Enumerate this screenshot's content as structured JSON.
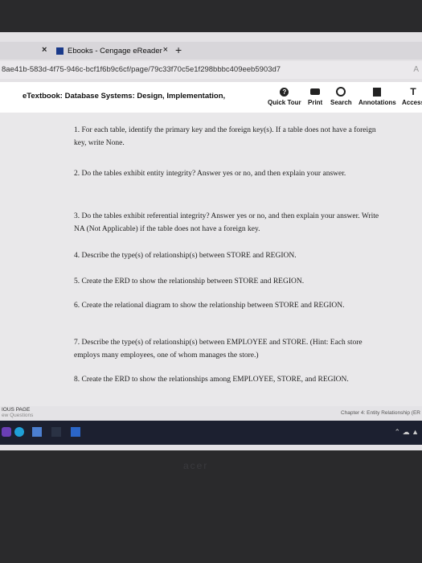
{
  "browser": {
    "tab_title": "Ebooks - Cengage eReader",
    "tab_close": "×",
    "new_tab": "+",
    "left_close": "×",
    "url": "8ae41b-583d-4f75-946c-bcf1f6b9c6cf/page/79c33f70c5e1f298bbbc409eeb5903d7",
    "url_right": "A"
  },
  "toolbar": {
    "title": "eTextbook: Database Systems: Design, Implementation,",
    "quick_tour": "Quick Tour",
    "print": "Print",
    "search": "Search",
    "annotations": "Annotations",
    "access": "Access",
    "access_icon_glyph": "T"
  },
  "questions": [
    "1. For each table, identify the primary key and the foreign key(s). If a table does not have a foreign key, write None.",
    "2. Do the tables exhibit entity integrity? Answer yes or no, and then explain your answer.",
    "3. Do the tables exhibit referential integrity? Answer yes or no, and then explain your answer. Write NA (Not Applicable) if the table does not have a foreign key.",
    "4. Describe the type(s) of relationship(s) between STORE and REGION.",
    "5. Create the ERD to show the relationship between STORE and REGION.",
    "6. Create the relational diagram to show the relationship between STORE and REGION.",
    "7. Describe the type(s) of relationship(s) between EMPLOYEE and STORE. (Hint: Each store employs many employees, one of whom manages the store.)",
    "8. Create the ERD to show the relationships among EMPLOYEE, STORE, and REGION."
  ],
  "status": {
    "previous_page": "IOUS PAGE",
    "previous_sub": "ew Questions",
    "chapter": "Chapter 4: Entity Relationship (ER"
  },
  "monitor": {
    "brand": "acer"
  }
}
